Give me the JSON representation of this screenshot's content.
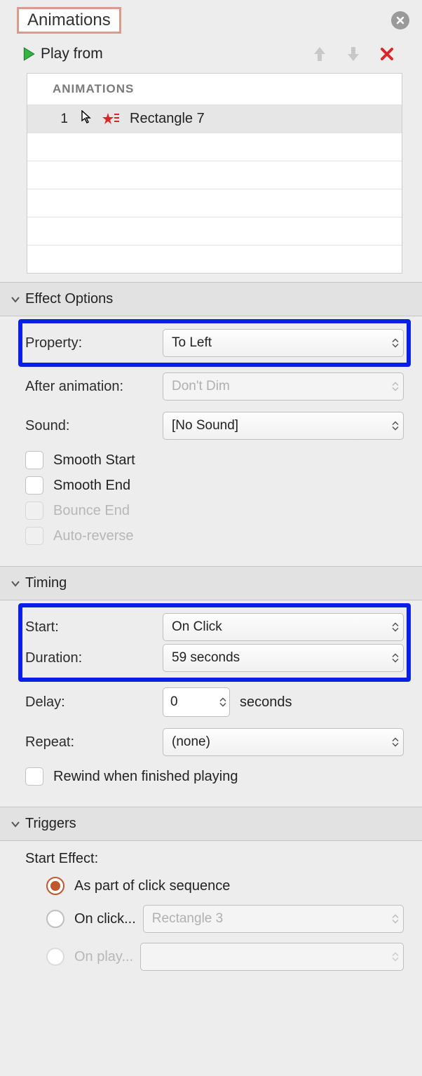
{
  "header": {
    "title": "Animations"
  },
  "playbar": {
    "label": "Play from"
  },
  "animations": {
    "header": "ANIMATIONS",
    "items": [
      {
        "index": "1",
        "name": "Rectangle 7"
      }
    ]
  },
  "sections": {
    "effect": {
      "title": "Effect Options",
      "property_label": "Property:",
      "property_value": "To Left",
      "after_label": "After animation:",
      "after_value": "Don't Dim",
      "sound_label": "Sound:",
      "sound_value": "[No Sound]",
      "checks": {
        "smooth_start": "Smooth Start",
        "smooth_end": "Smooth End",
        "bounce_end": "Bounce End",
        "auto_reverse": "Auto-reverse"
      }
    },
    "timing": {
      "title": "Timing",
      "start_label": "Start:",
      "start_value": "On Click",
      "duration_label": "Duration:",
      "duration_value": "59 seconds",
      "delay_label": "Delay:",
      "delay_value": "0",
      "delay_suffix": "seconds",
      "repeat_label": "Repeat:",
      "repeat_value": "(none)",
      "rewind": "Rewind when finished playing"
    },
    "triggers": {
      "title": "Triggers",
      "start_effect": "Start Effect:",
      "opt_sequence": "As part of click sequence",
      "opt_onclick": "On click...",
      "opt_onclick_value": "Rectangle 3",
      "opt_onplay": "On play..."
    }
  }
}
